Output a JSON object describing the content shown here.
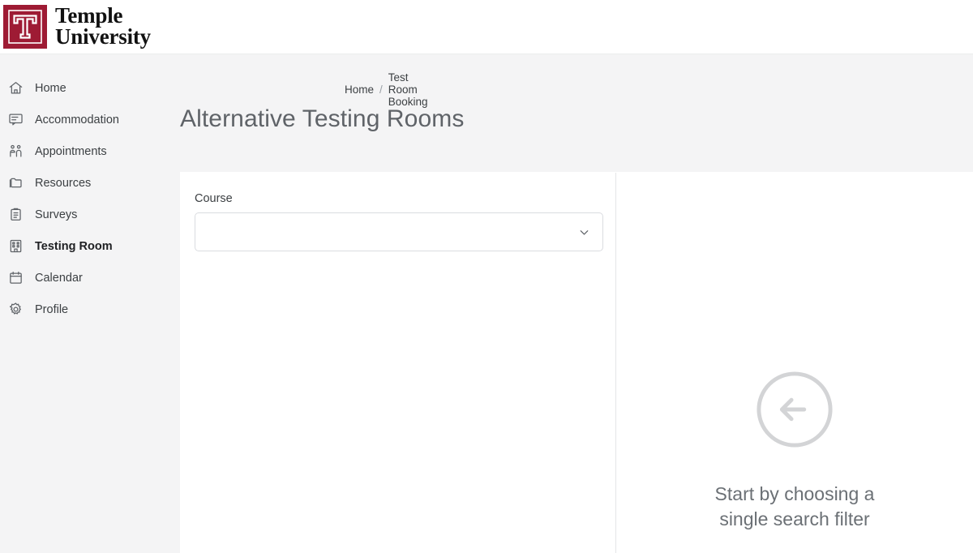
{
  "brand": {
    "logo_icon": "temple-t-logo",
    "name_line1": "Temple",
    "name_line2": "University",
    "accent_color": "#9E1B34"
  },
  "sidebar": {
    "items": [
      {
        "label": "Home",
        "icon": "home-icon",
        "active": false
      },
      {
        "label": "Accommodation",
        "icon": "comment-icon",
        "active": false
      },
      {
        "label": "Appointments",
        "icon": "people-icon",
        "active": false
      },
      {
        "label": "Resources",
        "icon": "folders-icon",
        "active": false
      },
      {
        "label": "Surveys",
        "icon": "clipboard-icon",
        "active": false
      },
      {
        "label": "Testing Room",
        "icon": "building-icon",
        "active": true
      },
      {
        "label": "Calendar",
        "icon": "calendar-icon",
        "active": false
      },
      {
        "label": "Profile",
        "icon": "gear-icon",
        "active": false
      }
    ]
  },
  "header": {
    "breadcrumb": [
      {
        "label": "Home"
      },
      {
        "label": "Test Room Booking"
      }
    ],
    "breadcrumb_separator": "/",
    "title": "Alternative Testing Rooms"
  },
  "filters": {
    "course": {
      "label": "Course",
      "value": "",
      "placeholder": "",
      "chevron_icon": "chevron-down-icon"
    }
  },
  "results": {
    "empty_state": {
      "icon": "arrow-left-circle-icon",
      "line1": "Start by choosing a",
      "line2": "single search filter"
    }
  },
  "colors": {
    "page_background": "#f4f4f5",
    "card_background": "#ffffff",
    "text_primary": "#3c4043",
    "text_muted": "#5f6368",
    "border": "#dadce0"
  }
}
